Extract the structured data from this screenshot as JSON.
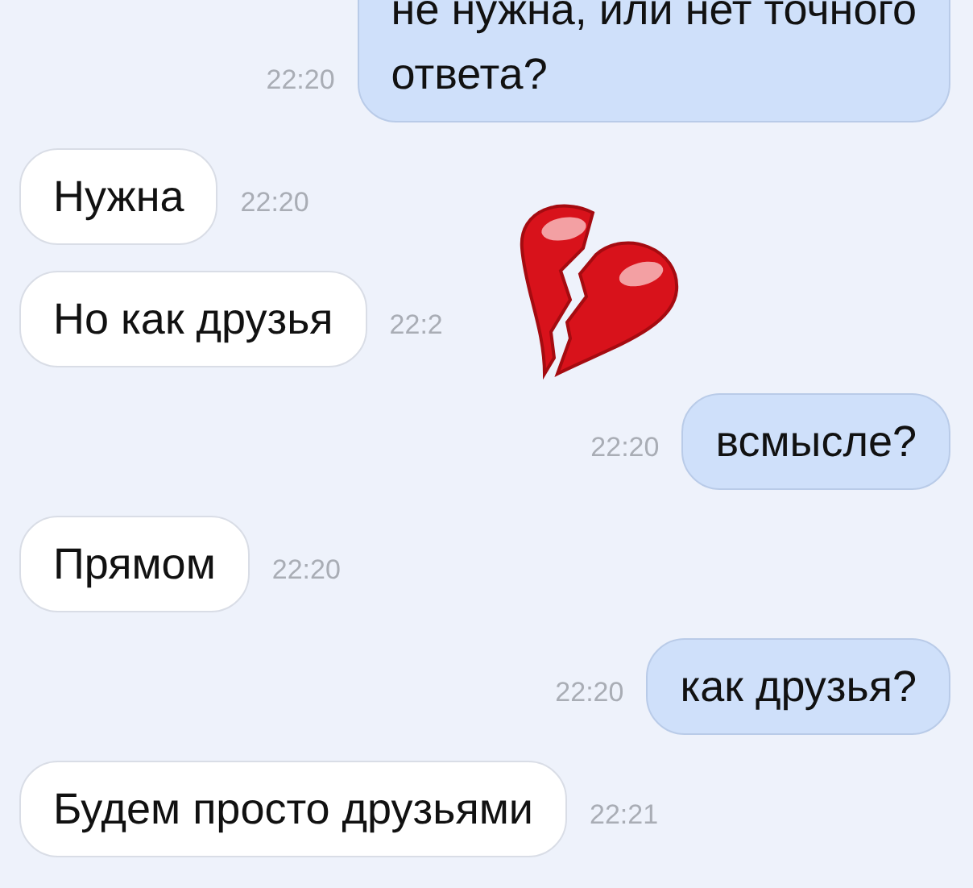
{
  "messages": [
    {
      "kind": "outgoing",
      "text": "не нужна, или нет точного\nответа?",
      "time": "22:20"
    },
    {
      "kind": "incoming",
      "text": "Нужна",
      "time": "22:20"
    },
    {
      "kind": "incoming",
      "text": "Но как друзья",
      "time": "22:2"
    },
    {
      "kind": "outgoing",
      "text": "всмысле?",
      "time": "22:20"
    },
    {
      "kind": "incoming",
      "text": "Прямом",
      "time": "22:20"
    },
    {
      "kind": "outgoing",
      "text": "как друзья?",
      "time": "22:20"
    },
    {
      "kind": "incoming",
      "text": "Будем просто друзьями",
      "time": "22:21"
    }
  ]
}
